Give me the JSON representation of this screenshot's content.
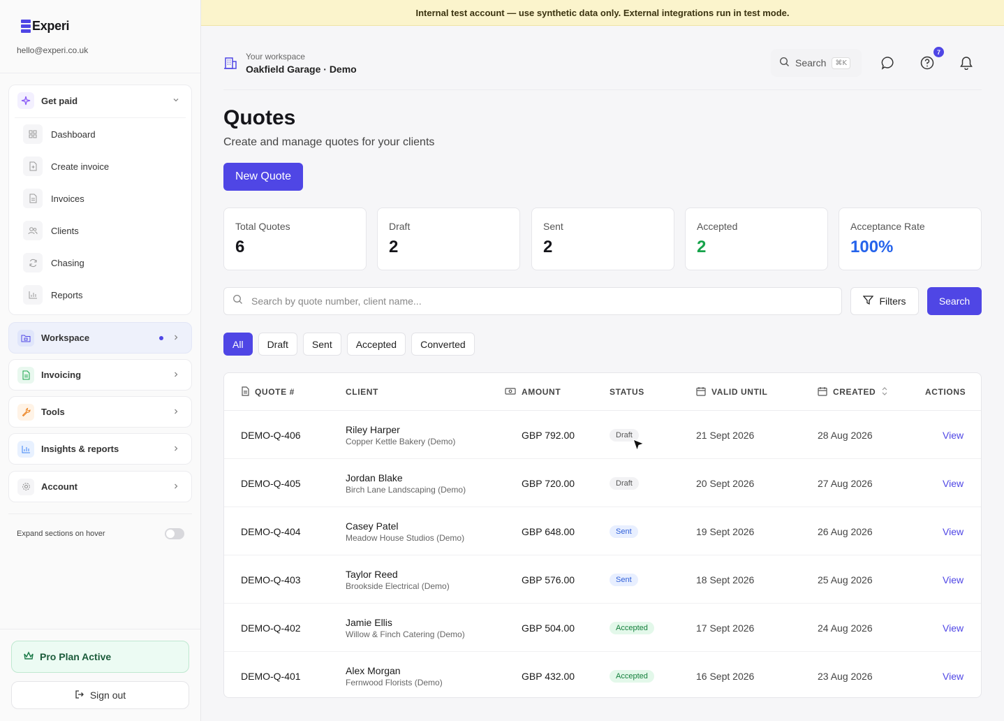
{
  "brand": {
    "name": "Experi",
    "email": "hello@experi.co.uk",
    "accent": "#4f46e5"
  },
  "banner": {
    "text": "Internal test account — use synthetic data only. External integrations run in test mode."
  },
  "sidebar": {
    "get_paid": {
      "label": "Get paid",
      "icon": "sparkle-icon",
      "items": [
        {
          "label": "Dashboard",
          "icon": "grid-icon"
        },
        {
          "label": "Create invoice",
          "icon": "file-plus-icon"
        },
        {
          "label": "Invoices",
          "icon": "document-icon"
        },
        {
          "label": "Clients",
          "icon": "users-icon"
        },
        {
          "label": "Chasing",
          "icon": "refresh-icon"
        },
        {
          "label": "Reports",
          "icon": "bar-chart-icon"
        }
      ]
    },
    "groups": [
      {
        "label": "Workspace",
        "icon": "folder-icon",
        "active": true
      },
      {
        "label": "Invoicing",
        "icon": "document-icon",
        "active": false
      },
      {
        "label": "Tools",
        "icon": "wrench-icon",
        "active": false
      },
      {
        "label": "Insights & reports",
        "icon": "bar-chart-icon",
        "active": false
      },
      {
        "label": "Account",
        "icon": "gear-icon",
        "active": false
      }
    ],
    "expand_on_hover": {
      "label": "Expand sections on hover",
      "enabled": false
    },
    "pro_plan": "Pro Plan Active",
    "sign_out": "Sign out"
  },
  "header": {
    "workspace_label": "Your workspace",
    "workspace_name": "Oakfield Garage · Demo",
    "search_label": "Search",
    "search_shortcut": "⌘K",
    "help_badge": "7"
  },
  "page": {
    "title": "Quotes",
    "subtitle": "Create and manage quotes for your clients",
    "new_quote": "New Quote"
  },
  "stats": [
    {
      "label": "Total Quotes",
      "value": "6",
      "color": "default"
    },
    {
      "label": "Draft",
      "value": "2",
      "color": "default"
    },
    {
      "label": "Sent",
      "value": "2",
      "color": "default"
    },
    {
      "label": "Accepted",
      "value": "2",
      "color": "green"
    },
    {
      "label": "Acceptance Rate",
      "value": "100%",
      "color": "blue"
    }
  ],
  "search": {
    "placeholder": "Search by quote number, client name...",
    "filters_label": "Filters",
    "search_label": "Search"
  },
  "filter_chips": [
    {
      "label": "All",
      "active": true
    },
    {
      "label": "Draft",
      "active": false
    },
    {
      "label": "Sent",
      "active": false
    },
    {
      "label": "Accepted",
      "active": false
    },
    {
      "label": "Converted",
      "active": false
    }
  ],
  "table": {
    "columns": {
      "quote": "QUOTE #",
      "client": "CLIENT",
      "amount": "AMOUNT",
      "status": "STATUS",
      "valid_until": "VALID UNTIL",
      "created": "CREATED",
      "actions": "ACTIONS"
    },
    "rows": [
      {
        "quote": "DEMO-Q-406",
        "client": "Riley Harper",
        "company": "Copper Kettle Bakery (Demo)",
        "amount": "GBP 792.00",
        "status": "Draft",
        "status_kind": "draft",
        "valid_until": "21 Sept 2026",
        "created": "28 Aug 2026",
        "action": "View"
      },
      {
        "quote": "DEMO-Q-405",
        "client": "Jordan Blake",
        "company": "Birch Lane Landscaping (Demo)",
        "amount": "GBP 720.00",
        "status": "Draft",
        "status_kind": "draft",
        "valid_until": "20 Sept 2026",
        "created": "27 Aug 2026",
        "action": "View"
      },
      {
        "quote": "DEMO-Q-404",
        "client": "Casey Patel",
        "company": "Meadow House Studios (Demo)",
        "amount": "GBP 648.00",
        "status": "Sent",
        "status_kind": "sent",
        "valid_until": "19 Sept 2026",
        "created": "26 Aug 2026",
        "action": "View"
      },
      {
        "quote": "DEMO-Q-403",
        "client": "Taylor Reed",
        "company": "Brookside Electrical (Demo)",
        "amount": "GBP 576.00",
        "status": "Sent",
        "status_kind": "sent",
        "valid_until": "18 Sept 2026",
        "created": "25 Aug 2026",
        "action": "View"
      },
      {
        "quote": "DEMO-Q-402",
        "client": "Jamie Ellis",
        "company": "Willow & Finch Catering (Demo)",
        "amount": "GBP 504.00",
        "status": "Accepted",
        "status_kind": "accepted",
        "valid_until": "17 Sept 2026",
        "created": "24 Aug 2026",
        "action": "View"
      },
      {
        "quote": "DEMO-Q-401",
        "client": "Alex Morgan",
        "company": "Fernwood Florists (Demo)",
        "amount": "GBP 432.00",
        "status": "Accepted",
        "status_kind": "accepted",
        "valid_until": "16 Sept 2026",
        "created": "23 Aug 2026",
        "action": "View"
      }
    ]
  }
}
